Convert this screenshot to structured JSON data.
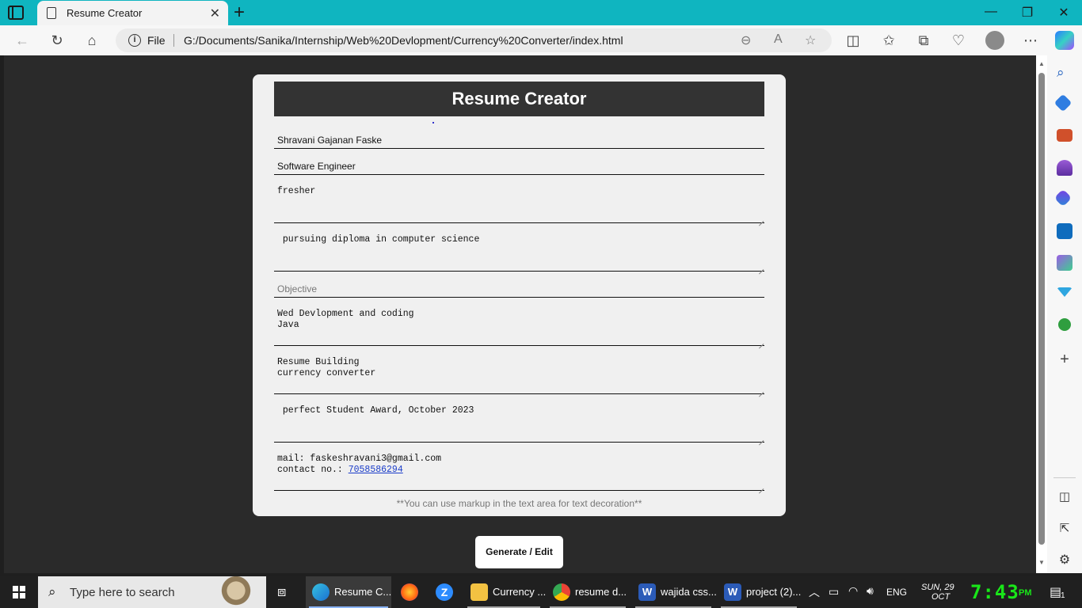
{
  "browser": {
    "tab_title": "Resume Creator",
    "url_scheme_label": "File",
    "url": "G:/Documents/Sanika/Internship/Web%20Devlopment/Currency%20Converter/index.html"
  },
  "page": {
    "title": "Resume Creator",
    "fields": {
      "name": "Shravani Gajanan Faske",
      "job_title": "Software Engineer",
      "experience": "fresher",
      "education": " pursuing diploma in computer science",
      "objective_placeholder": "Objective",
      "skills_line1": "Wed Devlopment and coding",
      "skills_line2": "Java",
      "projects_line1": "Resume Building",
      "projects_line2": "currency converter",
      "achievements": " perfect Student Award, October 2023",
      "contact_line1": "mail: faskeshravani3@gmail.com",
      "contact_prefix": "contact no.: ",
      "contact_phone": "7058586294"
    },
    "note": "**You can use markup in the text area for text decoration**",
    "generate_button": "Generate / Edit"
  },
  "taskbar": {
    "search_placeholder": "Type here to search",
    "apps": [
      {
        "label": "Resume C...",
        "icon": "edge-icon"
      },
      {
        "label": "",
        "icon": "firefox-icon"
      },
      {
        "label": "",
        "icon": "zoom-icon"
      },
      {
        "label": "Currency ...",
        "icon": "folder-icon"
      },
      {
        "label": "resume d...",
        "icon": "chrome-icon"
      },
      {
        "label": "wajida css...",
        "icon": "word-icon"
      },
      {
        "label": "project (2)...",
        "icon": "word-icon"
      }
    ],
    "language": "ENG",
    "date_line1": "SUN, 29",
    "date_line2": "OCT",
    "time": "7:43",
    "ampm": "PM",
    "notification_count": "1"
  },
  "colors": {
    "titlebar": "#0fb5c0",
    "page_bg": "#2a2a2a",
    "card_bg": "#f0f0f0",
    "header_bg": "#333333",
    "clock": "#19e619"
  }
}
